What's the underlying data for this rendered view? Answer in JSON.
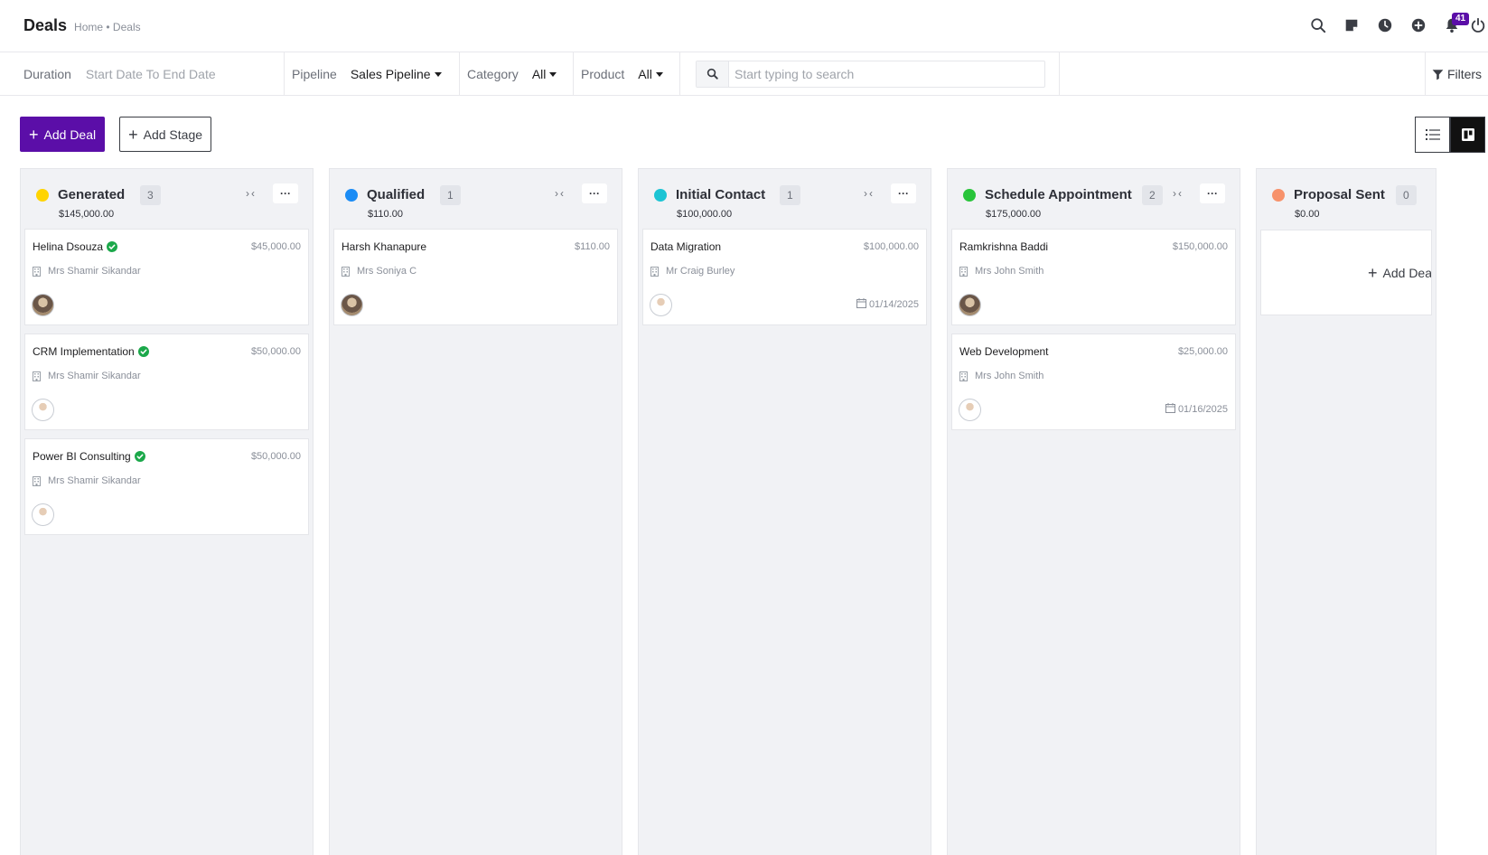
{
  "header": {
    "title": "Deals",
    "breadcrumb": "Home • Deals",
    "notification_count": "41",
    "icons": [
      "search-icon",
      "sticky-note-icon",
      "clock-icon",
      "plus-circle-icon",
      "bell-icon",
      "power-icon"
    ]
  },
  "filters": {
    "duration_label": "Duration",
    "duration_placeholder": "Start Date To End Date",
    "pipeline_label": "Pipeline",
    "pipeline_value": "Sales Pipeline",
    "category_label": "Category",
    "category_value": "All",
    "product_label": "Product",
    "product_value": "All",
    "search_placeholder": "Start typing to search",
    "filters_label": "Filters"
  },
  "actions": {
    "add_deal": "Add Deal",
    "add_stage": "Add Stage"
  },
  "colors": {
    "accent": "#5b0ea8",
    "generated": "#ffd400",
    "qualified": "#1b8cf5",
    "initial_contact": "#1cc4d4",
    "schedule_appointment": "#29c43a",
    "proposal_sent": "#f7926b",
    "verified": "#1ba84a"
  },
  "stages": [
    {
      "name": "Generated",
      "count": "3",
      "total": "$145,000.00",
      "deals": [
        {
          "title": "Helina Dsouza",
          "verified": true,
          "value": "$45,000.00",
          "contact": "Mrs Shamir Sikandar",
          "avatar": "dark",
          "date": ""
        },
        {
          "title": "CRM Implementation",
          "verified": true,
          "value": "$50,000.00",
          "contact": "Mrs Shamir Sikandar",
          "avatar": "light",
          "date": ""
        },
        {
          "title": "Power BI Consulting",
          "verified": true,
          "value": "$50,000.00",
          "contact": "Mrs Shamir Sikandar",
          "avatar": "light",
          "date": ""
        }
      ]
    },
    {
      "name": "Qualified",
      "count": "1",
      "total": "$110.00",
      "deals": [
        {
          "title": "Harsh Khanapure",
          "verified": false,
          "value": "$110.00",
          "contact": "Mrs Soniya C",
          "avatar": "dark",
          "date": ""
        }
      ]
    },
    {
      "name": "Initial Contact",
      "count": "1",
      "total": "$100,000.00",
      "deals": [
        {
          "title": "Data Migration",
          "verified": false,
          "value": "$100,000.00",
          "contact": "Mr Craig Burley",
          "avatar": "light",
          "date": "01/14/2025"
        }
      ]
    },
    {
      "name": "Schedule Appointment",
      "count": "2",
      "total": "$175,000.00",
      "deals": [
        {
          "title": "Ramkrishna Baddi",
          "verified": false,
          "value": "$150,000.00",
          "contact": "Mrs John Smith",
          "avatar": "dark",
          "date": ""
        },
        {
          "title": "Web Development",
          "verified": false,
          "value": "$25,000.00",
          "contact": "Mrs John Smith",
          "avatar": "light",
          "date": "01/16/2025"
        }
      ]
    },
    {
      "name": "Proposal Sent",
      "count": "0",
      "total": "$0.00",
      "deals": [],
      "add_deal_label": "Add Deal"
    }
  ]
}
